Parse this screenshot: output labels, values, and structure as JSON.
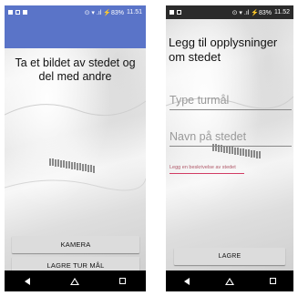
{
  "left_screen": {
    "status_time": "11.51",
    "status_icons": "⊙ ▾ .ıl ⚡83%",
    "title": "Ta et bildet av stedet og del med andre",
    "buttons": {
      "camera": "KAMERA",
      "save_trip": "LAGRE TUR MÅL"
    }
  },
  "right_screen": {
    "status_time": "11.52",
    "status_icons": "⊙ ▾ .ıl ⚡83%",
    "title": "Legg til opplysninger om stedet",
    "fields": {
      "type_placeholder": "Type turmål",
      "name_placeholder": "Navn på stedet",
      "description_placeholder": "Legg en beskrivelse av stedet"
    },
    "buttons": {
      "save": "LAGRE"
    }
  },
  "navbar": {
    "back": "◁",
    "home": "△",
    "recent": "□"
  },
  "colors": {
    "appbar": "#5a74c8",
    "navbar": "#000000",
    "accent_field": "#d23c64"
  }
}
